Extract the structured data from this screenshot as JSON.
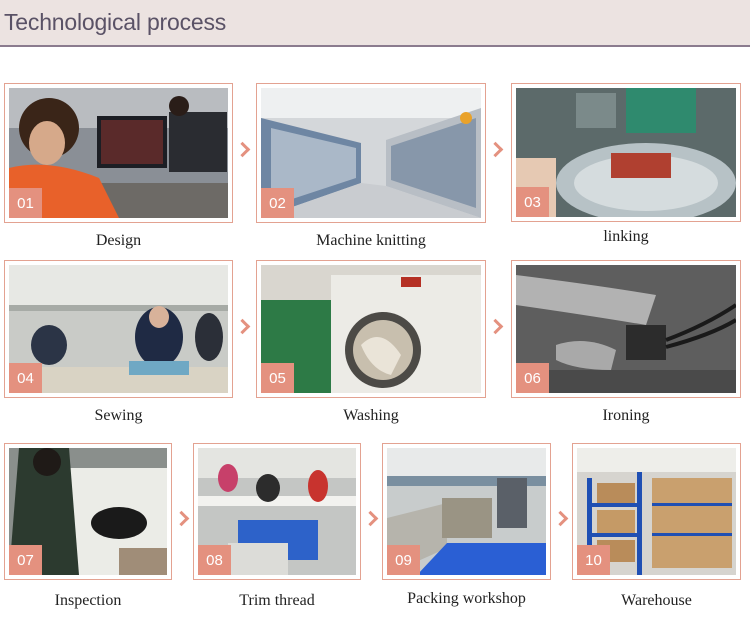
{
  "header": {
    "title": "Technological process"
  },
  "steps": [
    {
      "num": "01",
      "label": "Design"
    },
    {
      "num": "02",
      "label": "Machine knitting"
    },
    {
      "num": "03",
      "label": "linking"
    },
    {
      "num": "04",
      "label": "Sewing"
    },
    {
      "num": "05",
      "label": "Washing"
    },
    {
      "num": "06",
      "label": "Ironing"
    },
    {
      "num": "07",
      "label": "Inspection"
    },
    {
      "num": "08",
      "label": "Trim thread"
    },
    {
      "num": "09",
      "label": "Packing workshop"
    },
    {
      "num": "10",
      "label": "Warehouse"
    }
  ],
  "colors": {
    "accent": "#e4917f",
    "header_bg": "#ece3e1",
    "header_text": "#5a5266"
  }
}
